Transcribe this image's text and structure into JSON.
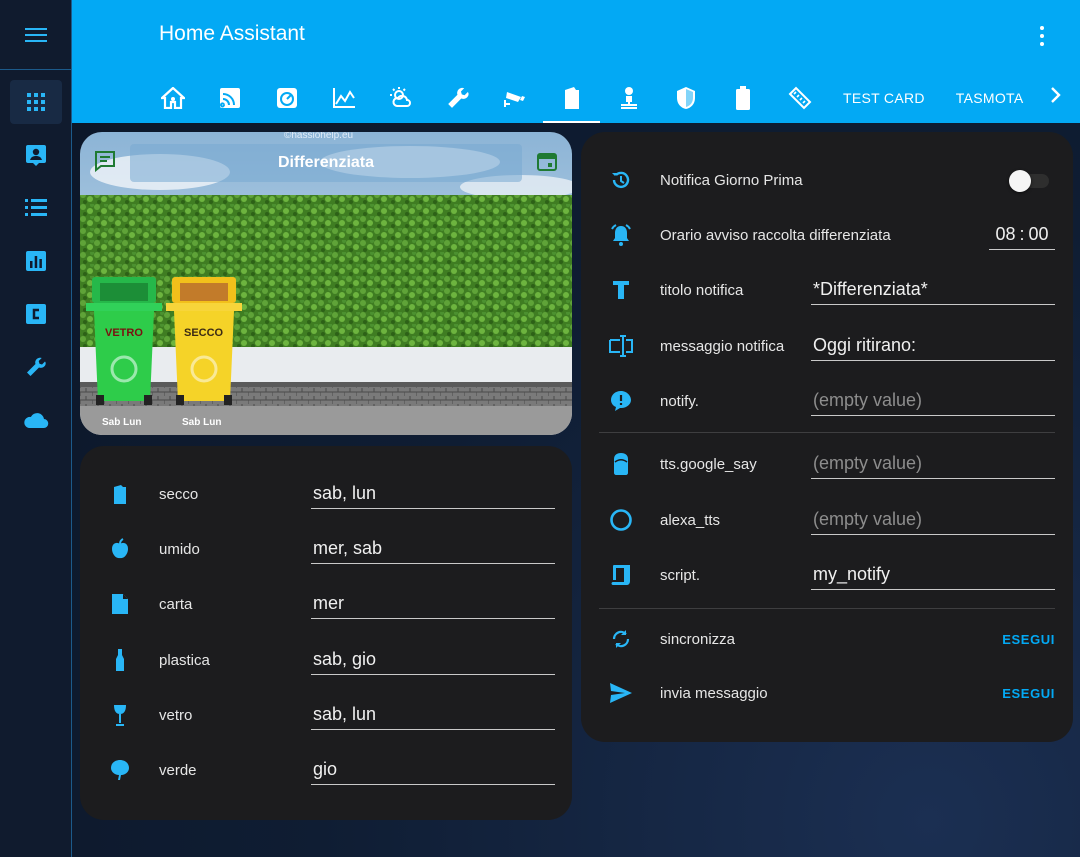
{
  "app": {
    "title": "Home Assistant"
  },
  "colors": {
    "accent": "#03a9f4",
    "sidebar_bg": "#101b2e",
    "card_bg": "#1c1c1e"
  },
  "sidebar": {
    "items": [
      {
        "icon": "grid-icon",
        "active": true
      },
      {
        "icon": "account-box-icon"
      },
      {
        "icon": "list-icon"
      },
      {
        "icon": "chart-icon"
      },
      {
        "icon": "code-icon"
      },
      {
        "icon": "wrench-icon"
      },
      {
        "icon": "cloud-icon"
      }
    ]
  },
  "tabs": {
    "icon_tabs": [
      "home-icon",
      "signal-icon",
      "gauge-icon",
      "chart-line-icon",
      "weather-icon",
      "wrench-icon",
      "cctv-icon",
      "trash-icon",
      "network-icon",
      "shield-icon",
      "battery-icon",
      "ruler-icon"
    ],
    "active_index": 7,
    "text_tabs": [
      "TEST CARD",
      "TASMOTA"
    ]
  },
  "picture_card": {
    "title": "Differenziata",
    "watermark": "©hassiohelp.eu",
    "bins": [
      {
        "label": "VETRO",
        "days": "Sab Lun",
        "color": "#2ecc4a"
      },
      {
        "label": "SECCO",
        "days": "Sab Lun",
        "color": "#f5d328"
      }
    ]
  },
  "schedule": [
    {
      "icon": "trash-icon",
      "label": "secco",
      "value": "sab, lun"
    },
    {
      "icon": "apple-icon",
      "label": "umido",
      "value": "mer, sab"
    },
    {
      "icon": "file-icon",
      "label": "carta",
      "value": "mer"
    },
    {
      "icon": "bottle-icon",
      "label": "plastica",
      "value": "sab, gio"
    },
    {
      "icon": "glass-icon",
      "label": "vetro",
      "value": "sab, lun"
    },
    {
      "icon": "tree-icon",
      "label": "verde",
      "value": "gio"
    }
  ],
  "settings": {
    "notifica_giorno_prima": {
      "label": "Notifica Giorno Prima",
      "state": "off"
    },
    "orario": {
      "label": "Orario avviso raccolta differenziata",
      "hours": "08",
      "sep": ":",
      "minutes": "00"
    },
    "titolo": {
      "label": "titolo notifica",
      "value": "*Differenziata*"
    },
    "messaggio": {
      "label": "messaggio notifica",
      "value": "Oggi ritirano:"
    },
    "notify": {
      "label": "notify.",
      "value": "(empty value)"
    },
    "tts": {
      "label": "tts.google_say",
      "value": "(empty value)"
    },
    "alexa": {
      "label": "alexa_tts",
      "value": "(empty value)"
    },
    "script": {
      "label": "script.",
      "value": "my_notify"
    },
    "sincronizza": {
      "label": "sincronizza",
      "action": "ESEGUI"
    },
    "invia": {
      "label": "invia messaggio",
      "action": "ESEGUI"
    }
  }
}
